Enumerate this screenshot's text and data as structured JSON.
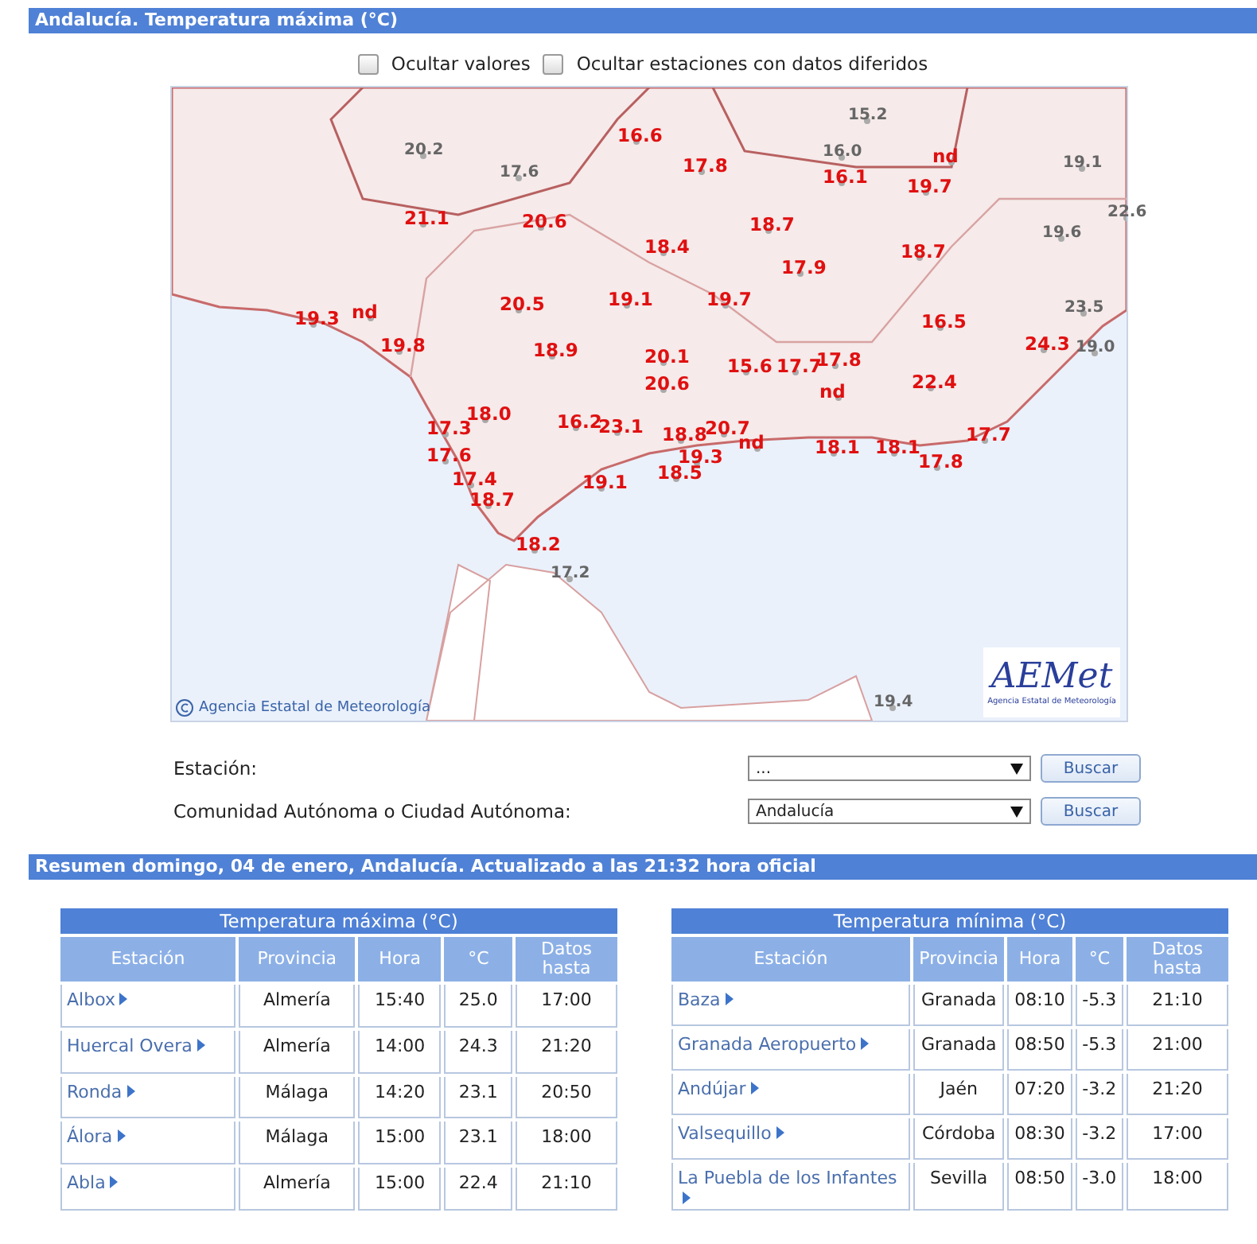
{
  "header": {
    "title": "Andalucía. Temperatura máxima (°C)"
  },
  "options": [
    {
      "label": "Ocultar valores",
      "checked": false
    },
    {
      "label": "Ocultar estaciones con datos diferidos",
      "checked": false
    }
  ],
  "map": {
    "copyright": "Agencia Estatal de Meteorología",
    "logo": {
      "name": "AEMet",
      "subtitle": "Agencia Estatal de Meteorología"
    },
    "labels": [
      {
        "text": "20.2",
        "kind": "outside"
      },
      {
        "text": "17.6",
        "kind": "outside"
      },
      {
        "text": "15.2",
        "kind": "outside"
      },
      {
        "text": "16.0",
        "kind": "outside"
      },
      {
        "text": "19.1",
        "kind": "outside"
      },
      {
        "text": "22.6",
        "kind": "outside"
      },
      {
        "text": "19.6",
        "kind": "outside"
      },
      {
        "text": "23.5",
        "kind": "outside"
      },
      {
        "text": "19.0",
        "kind": "outside"
      },
      {
        "text": "17.2",
        "kind": "outside"
      },
      {
        "text": "19.4",
        "kind": "outside"
      },
      {
        "text": "16.6",
        "kind": "region"
      },
      {
        "text": "17.8",
        "kind": "region"
      },
      {
        "text": "16.1",
        "kind": "region"
      },
      {
        "text": "nd",
        "kind": "region"
      },
      {
        "text": "19.7",
        "kind": "region"
      },
      {
        "text": "21.1",
        "kind": "region"
      },
      {
        "text": "20.6",
        "kind": "region"
      },
      {
        "text": "18.7",
        "kind": "region"
      },
      {
        "text": "18.4",
        "kind": "region"
      },
      {
        "text": "18.7",
        "kind": "region"
      },
      {
        "text": "17.9",
        "kind": "region"
      },
      {
        "text": "20.5",
        "kind": "region"
      },
      {
        "text": "19.1",
        "kind": "region"
      },
      {
        "text": "19.7",
        "kind": "region"
      },
      {
        "text": "16.5",
        "kind": "region"
      },
      {
        "text": "24.3",
        "kind": "region"
      },
      {
        "text": "19.3",
        "kind": "region"
      },
      {
        "text": "nd",
        "kind": "region"
      },
      {
        "text": "19.8",
        "kind": "region"
      },
      {
        "text": "18.9",
        "kind": "region"
      },
      {
        "text": "20.1",
        "kind": "region"
      },
      {
        "text": "20.6",
        "kind": "region"
      },
      {
        "text": "15.6",
        "kind": "region"
      },
      {
        "text": "17.7",
        "kind": "region"
      },
      {
        "text": "17.8",
        "kind": "region"
      },
      {
        "text": "nd",
        "kind": "region"
      },
      {
        "text": "22.4",
        "kind": "region"
      },
      {
        "text": "18.0",
        "kind": "region"
      },
      {
        "text": "17.3",
        "kind": "region"
      },
      {
        "text": "16.2",
        "kind": "region"
      },
      {
        "text": "23.1",
        "kind": "region"
      },
      {
        "text": "18.8",
        "kind": "region"
      },
      {
        "text": "20.7",
        "kind": "region"
      },
      {
        "text": "19.3",
        "kind": "region"
      },
      {
        "text": "18.5",
        "kind": "region"
      },
      {
        "text": "nd",
        "kind": "region"
      },
      {
        "text": "18.1",
        "kind": "region"
      },
      {
        "text": "18.1",
        "kind": "region"
      },
      {
        "text": "17.7",
        "kind": "region"
      },
      {
        "text": "17.8",
        "kind": "region"
      },
      {
        "text": "17.6",
        "kind": "region"
      },
      {
        "text": "17.4",
        "kind": "region"
      },
      {
        "text": "19.1",
        "kind": "region"
      },
      {
        "text": "18.7",
        "kind": "region"
      },
      {
        "text": "18.2",
        "kind": "region"
      }
    ]
  },
  "search": [
    {
      "label": "Estación:",
      "value": "...",
      "button": "Buscar"
    },
    {
      "label": "Comunidad Autónoma o Ciudad Autónoma:",
      "value": "Andalucía",
      "button": "Buscar"
    }
  ],
  "summary": {
    "title": "Resumen domingo, 04 de enero, Andalucía. Actualizado a las 21:32 hora oficial"
  },
  "tables": [
    {
      "title": "Temperatura máxima (°C)",
      "columns": [
        "Estación",
        "Provincia",
        "Hora",
        "°C",
        "Datos hasta"
      ],
      "rows": [
        [
          "Albox",
          "Almería",
          "15:40",
          "25.0",
          "17:00"
        ],
        [
          "Huercal Overa",
          "Almería",
          "14:00",
          "24.3",
          "21:20"
        ],
        [
          "Ronda",
          "Málaga",
          "14:20",
          "23.1",
          "20:50"
        ],
        [
          "Álora",
          "Málaga",
          "15:00",
          "23.1",
          "18:00"
        ],
        [
          "Abla",
          "Almería",
          "15:00",
          "22.4",
          "21:10"
        ]
      ]
    },
    {
      "title": "Temperatura mínima (°C)",
      "columns": [
        "Estación",
        "Provincia",
        "Hora",
        "°C",
        "Datos hasta"
      ],
      "rows": [
        [
          "Baza",
          "Granada",
          "08:10",
          "-5.3",
          "21:10"
        ],
        [
          "Granada Aeropuerto",
          "Granada",
          "08:50",
          "-5.3",
          "21:00"
        ],
        [
          "Andújar",
          "Jaén",
          "07:20",
          "-3.2",
          "21:20"
        ],
        [
          "Valsequillo",
          "Córdoba",
          "08:30",
          "-3.2",
          "17:00"
        ],
        [
          "La Puebla de los Infantes",
          "Sevilla",
          "08:50",
          "-3.0",
          "18:00"
        ]
      ]
    }
  ]
}
